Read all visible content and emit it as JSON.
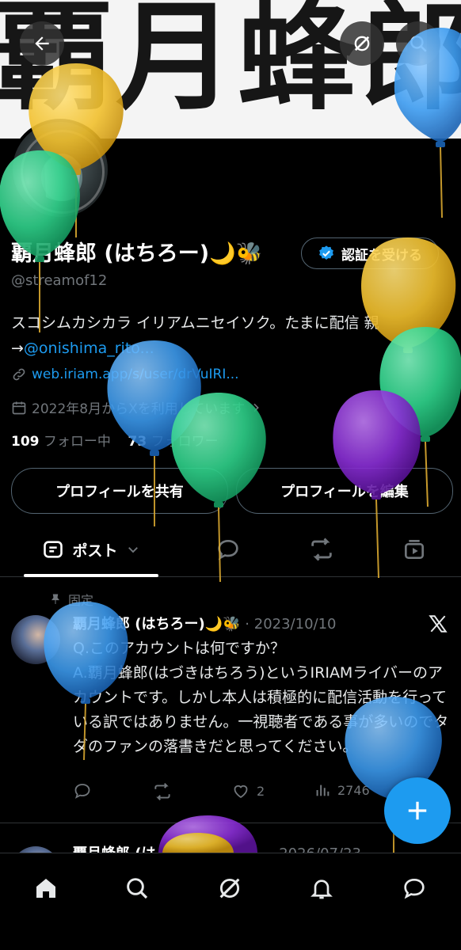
{
  "banner": {
    "text": "覇月蜂郎"
  },
  "profile": {
    "name": "覇月蜂郎 (はちろー)🌙🐝",
    "handle": "@streamof12",
    "verify_label": "認証を受ける",
    "bio_line1": "スコシムカシカラ イリアムニセイソク。たまに配信 親",
    "bio_arrow": "→",
    "bio_mention": "@onishima_rito...",
    "website": "web.iriam.app/s/user/drVuIRI...",
    "joined": "2022年8月からXを利用しています",
    "following_count": "109",
    "following_label": "フォロー中",
    "followers_count": "73",
    "followers_label": "フォロワー",
    "share_button": "プロフィールを共有",
    "edit_button": "プロフィールを編集"
  },
  "tabs": {
    "posts_label": "ポスト"
  },
  "pinned_post": {
    "pinned_label": "固定",
    "author": "覇月蜂郎 (はちろー)🌙🐝",
    "date": "2023/10/10",
    "separator": "·",
    "line1": "Q.このアカウントは何ですか？",
    "line2": "A.覇月蜂郎(はづきはちろう)というIRIAMライバーのアカウントです。しかし本人は積極的に配信活動を行っている訳ではありません。一視聴者である事が多いのでタダのファンの落書きだと思ってください。",
    "likes": "2",
    "views": "2746"
  },
  "second_post": {
    "author": "覇月蜂郎 (は",
    "date": "2026/07/23"
  },
  "colors": {
    "accent": "#1d9bf0",
    "balloon_yellow": "#f2c12e",
    "balloon_green": "#2fd18a",
    "balloon_blue": "#3d9cf0",
    "balloon_purple": "#8a2fd6"
  },
  "icons": [
    "back-arrow-icon",
    "grok-icon",
    "search-icon",
    "verified-badge-icon",
    "link-icon",
    "calendar-icon",
    "chevron-right-icon",
    "post-tab-icon",
    "chevron-down-icon",
    "replies-icon",
    "reposts-icon",
    "media-icon",
    "pin-icon",
    "x-logo-icon",
    "reply-icon",
    "retweet-icon",
    "like-icon",
    "views-icon",
    "plus-icon",
    "home-icon",
    "grok-nav-icon",
    "notifications-icon",
    "messages-icon",
    "balloon-icon"
  ]
}
